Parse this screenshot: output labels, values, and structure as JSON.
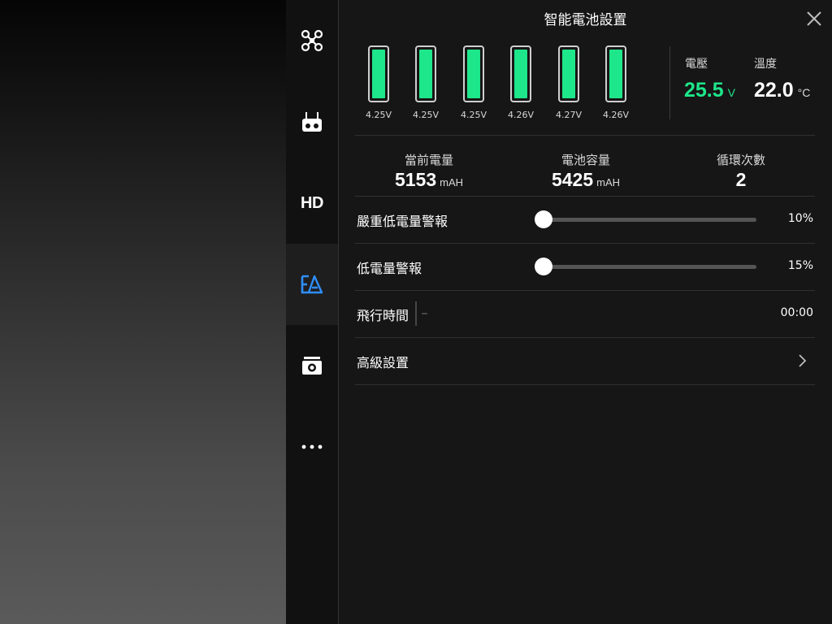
{
  "panel": {
    "title": "智能電池設置"
  },
  "sidebar": {
    "items": [
      {
        "name": "aircraft",
        "icon": "drone-icon",
        "active": false
      },
      {
        "name": "remote-controller",
        "icon": "remote-controller-icon",
        "active": false
      },
      {
        "name": "hd",
        "label": "HD",
        "active": false
      },
      {
        "name": "battery",
        "icon": "battery-settings-icon",
        "active": true
      },
      {
        "name": "camera",
        "icon": "camera-icon",
        "active": false
      },
      {
        "name": "more",
        "icon": "more-dots-icon",
        "active": false
      }
    ]
  },
  "battery": {
    "cells": [
      {
        "voltage": "4.25V"
      },
      {
        "voltage": "4.25V"
      },
      {
        "voltage": "4.25V"
      },
      {
        "voltage": "4.26V"
      },
      {
        "voltage": "4.27V"
      },
      {
        "voltage": "4.26V"
      }
    ],
    "voltage": {
      "label": "電壓",
      "value": "25.5",
      "unit": "V"
    },
    "temperature": {
      "label": "溫度",
      "value": "22.0",
      "unit": "°C"
    },
    "current_charge": {
      "label": "當前電量",
      "value": "5153",
      "unit": "mAH"
    },
    "capacity": {
      "label": "電池容量",
      "value": "5425",
      "unit": "mAH"
    },
    "cycles": {
      "label": "循環次數",
      "value": "2"
    }
  },
  "settings": {
    "critical_low": {
      "label": "嚴重低電量警報",
      "value": "10%",
      "fraction": 0.0
    },
    "low": {
      "label": "低電量警報",
      "value": "15%",
      "fraction": 0.0
    },
    "flight_time": {
      "label": "飛行時間",
      "value": "00:00"
    },
    "advanced": {
      "label": "高級設置"
    }
  },
  "colors": {
    "accent_green": "#1ee68a",
    "accent_blue": "#2f8fff"
  }
}
